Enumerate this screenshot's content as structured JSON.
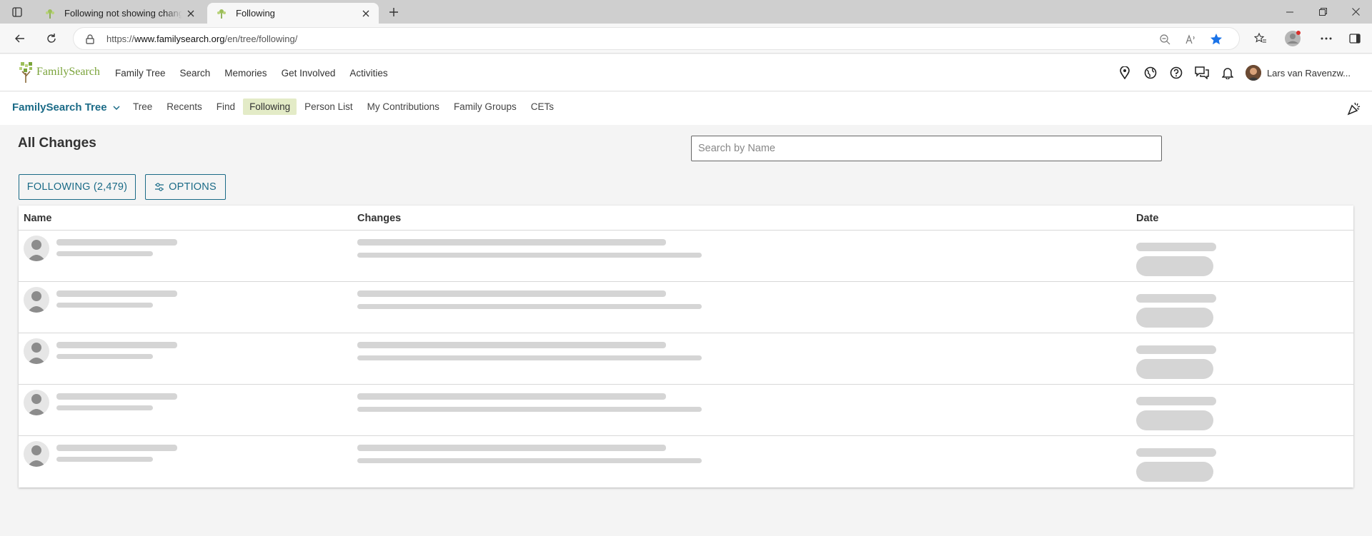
{
  "browser": {
    "tabs": [
      {
        "title": "Following not showing changes o",
        "active": false
      },
      {
        "title": "Following",
        "active": true
      }
    ],
    "url_prefix": "https://",
    "url_host": "www.familysearch.org",
    "url_path": "/en/tree/following/",
    "accent_color": "#1a73e8"
  },
  "header": {
    "logo_text": "FamilySearch",
    "nav": [
      "Family Tree",
      "Search",
      "Memories",
      "Get Involved",
      "Activities"
    ],
    "icons": [
      "location-pin-icon",
      "globe-icon",
      "help-icon",
      "chat-icon",
      "bell-icon"
    ],
    "user_name": "Lars van Ravenzw..."
  },
  "subnav": {
    "title": "FamilySearch Tree",
    "items": [
      "Tree",
      "Recents",
      "Find",
      "Following",
      "Person List",
      "My Contributions",
      "Family Groups",
      "CETs"
    ],
    "active_item": "Following"
  },
  "page": {
    "title": "All Changes",
    "search_placeholder": "Search by Name",
    "following_button": "FOLLOWING (2,479)",
    "options_button": "OPTIONS",
    "brand_color": "#1b6b87",
    "highlight_color": "#e3ebc7"
  },
  "table": {
    "columns": [
      "Name",
      "Changes",
      "Date"
    ],
    "loading": true,
    "placeholder_row_count": 5
  }
}
